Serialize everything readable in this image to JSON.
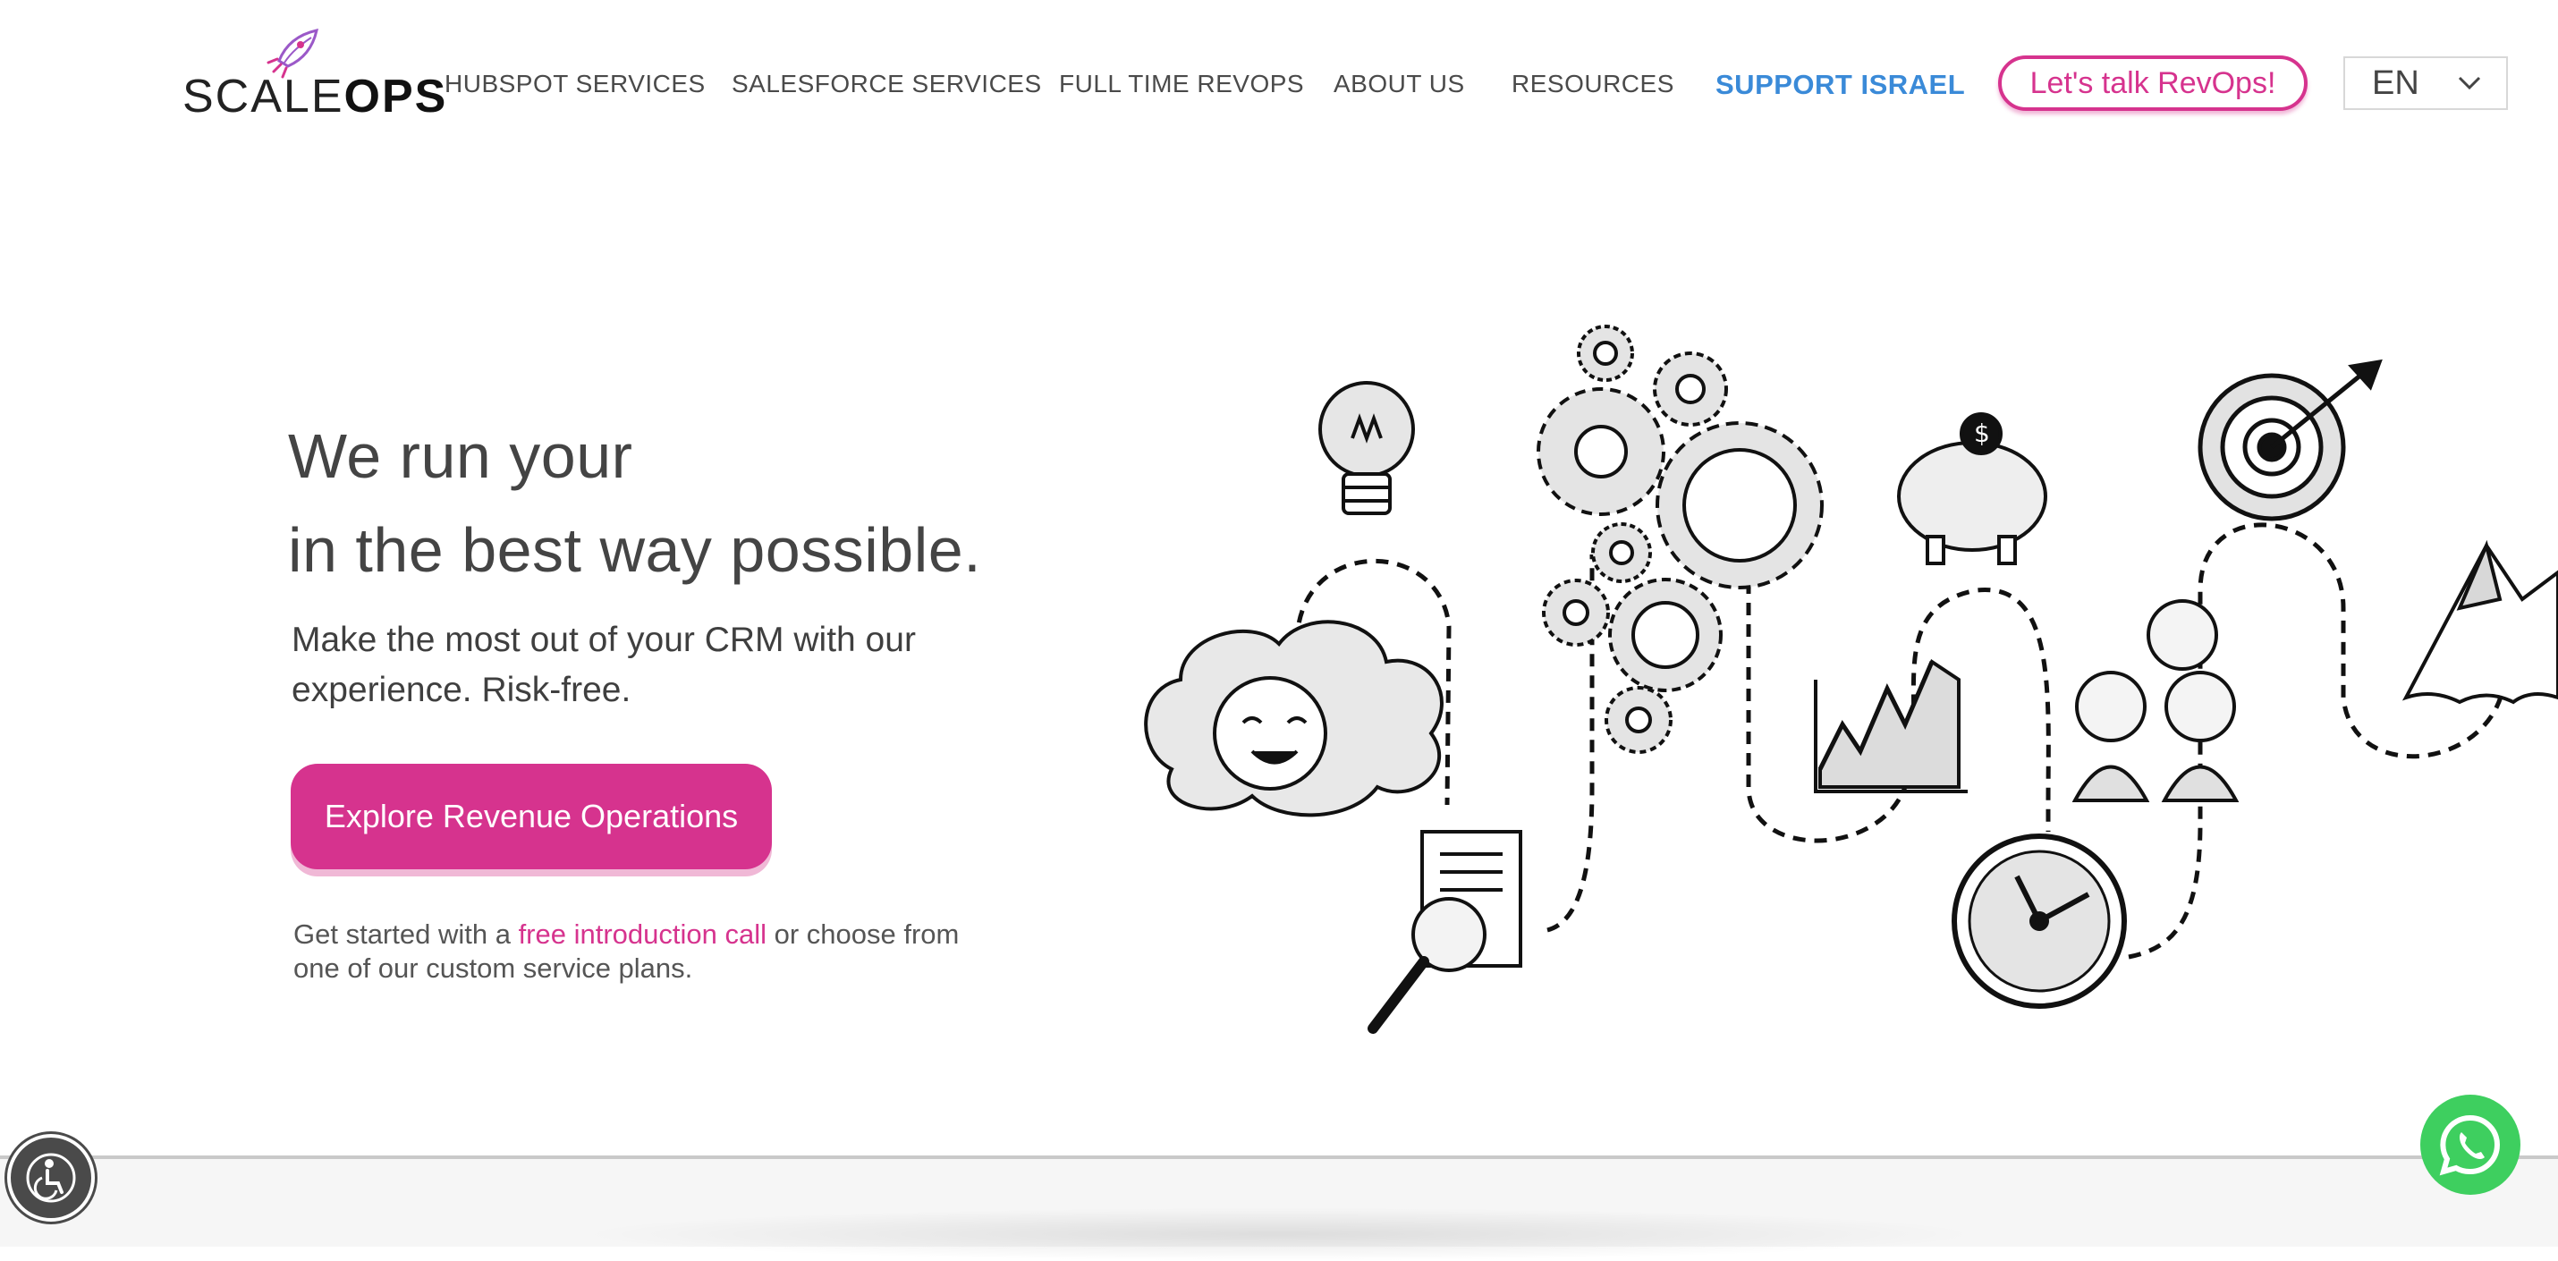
{
  "logo": {
    "part1": "SCALE",
    "part2": "OPS",
    "icon": "rocket-logo-icon"
  },
  "nav": [
    {
      "label": "HUBSPOT SERVICES"
    },
    {
      "label": "SALESFORCE SERVICES"
    },
    {
      "label": "FULL TIME REVOPS"
    },
    {
      "label": "ABOUT US"
    },
    {
      "label": "RESOURCES"
    },
    {
      "label": "SUPPORT ISRAEL"
    }
  ],
  "header": {
    "cta_label": "Let's talk RevOps!",
    "language": "EN"
  },
  "hero": {
    "title_line1": "We run your",
    "title_line2": "in the best way possible.",
    "subtitle": "Make the most out of your CRM with our experience. Risk-free.",
    "button_label": "Explore Revenue Operations",
    "note_before": "Get started with a ",
    "note_link": "free introduction call",
    "note_after": " or choose from one of our custom service plans."
  },
  "floating": {
    "accessibility_icon": "accessibility-icon",
    "whatsapp_icon": "whatsapp-icon"
  },
  "colors": {
    "brand_pink": "#d6338e",
    "support_blue": "#3a8ad8",
    "whatsapp_green": "#3ecf5f"
  }
}
